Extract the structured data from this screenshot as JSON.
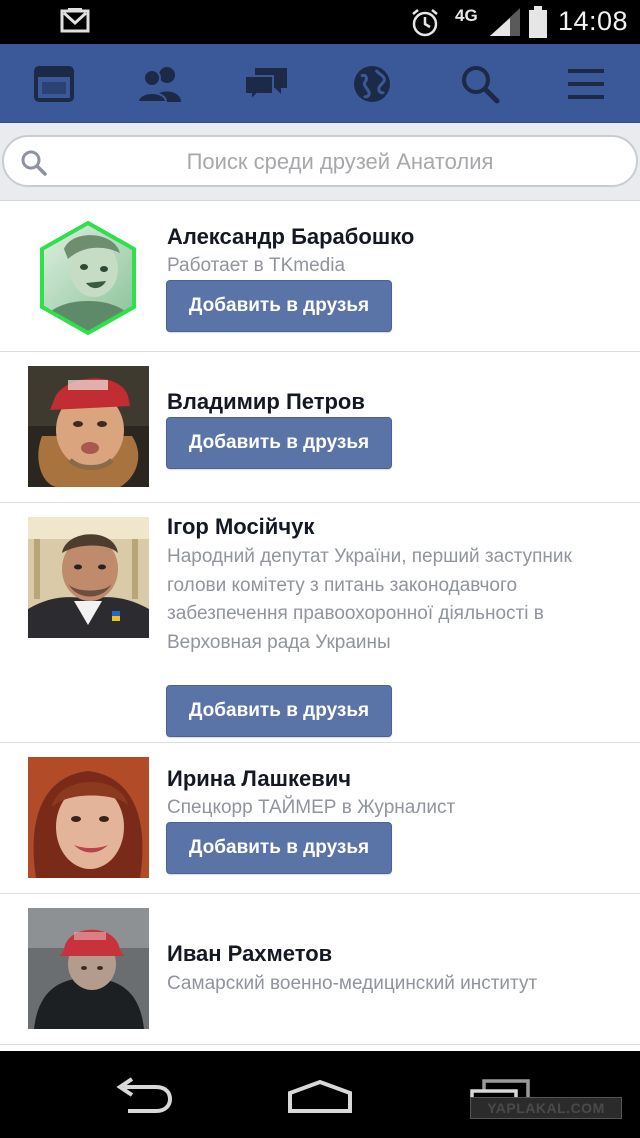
{
  "status_bar": {
    "network": "4G",
    "time": "14:08",
    "icons": [
      "gmail-icon",
      "alarm-icon",
      "signal-icon",
      "battery-icon"
    ]
  },
  "navbar": {
    "color": "#3b5998",
    "items": [
      "news-feed-icon",
      "friend-requests-icon",
      "messages-icon",
      "notifications-globe-icon",
      "search-icon",
      "menu-icon"
    ]
  },
  "search": {
    "placeholder": "Поиск среди друзей Анатолия",
    "value": ""
  },
  "friends": [
    {
      "name": "Александр Барабошко",
      "subtitle": "Работает в TKmedia",
      "button": "Добавить в друзья",
      "avatar": "hexagon-profile-photo"
    },
    {
      "name": "Владимир Петров",
      "subtitle": "",
      "button": "Добавить в друзья",
      "avatar": "profile-photo"
    },
    {
      "name": "Ігор Мосійчук",
      "subtitle": "Народний депутат України, перший заступник голови комітету з питань законодавчого забезпечення правоохоронної діяльності в Верховная рада Украины",
      "button": "Добавить в друзья",
      "avatar": "profile-photo"
    },
    {
      "name": "Ирина Лашкевич",
      "subtitle": "Спецкорр ТАЙМЕР в Журналист",
      "button": "Добавить в друзья",
      "avatar": "profile-photo"
    },
    {
      "name": "Иван Рахметов",
      "subtitle": "Самарский военно-медицинский институт",
      "button": "",
      "avatar": "profile-photo"
    }
  ],
  "system_nav": {
    "items": [
      "back-icon",
      "home-icon",
      "recents-icon"
    ]
  },
  "watermark": "YAPLAKAL.COM"
}
